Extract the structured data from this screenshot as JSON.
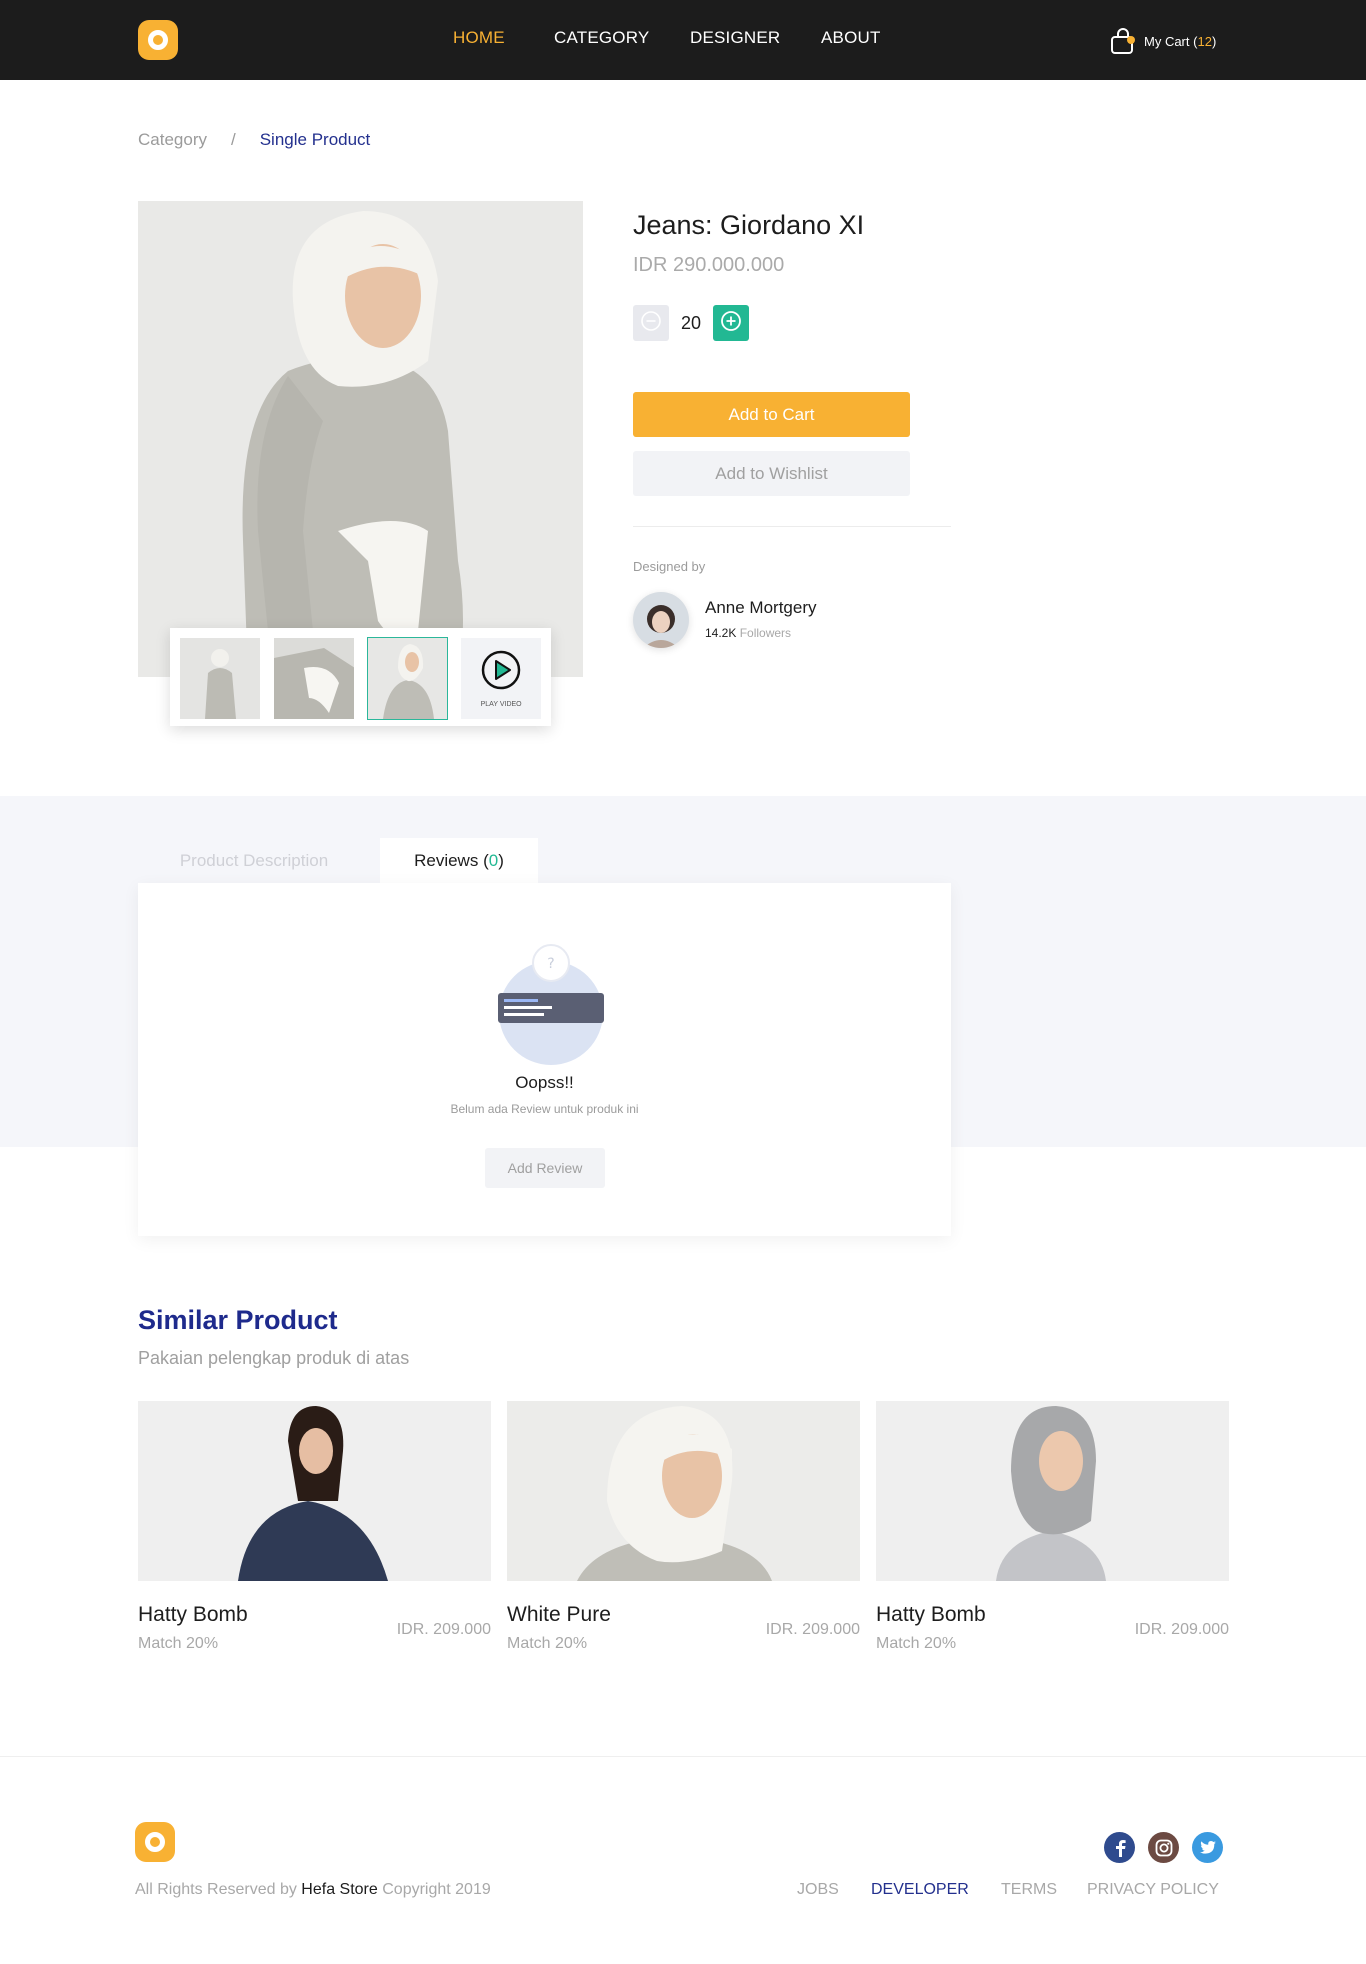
{
  "nav": {
    "items": [
      {
        "label": "HOME",
        "active": true
      },
      {
        "label": "CATEGORY",
        "active": false
      },
      {
        "label": "DESIGNER",
        "active": false
      },
      {
        "label": "ABOUT",
        "active": false
      }
    ],
    "cart_label": "My Cart",
    "cart_count": "12",
    "cart_open": "(",
    "cart_close": ")"
  },
  "breadcrumb": {
    "parent": "Category",
    "separator": "/",
    "current": "Single Product"
  },
  "product": {
    "title": "Jeans: Giordano XI",
    "price": "IDR 290.000.000",
    "quantity": "20",
    "add_to_cart": "Add to Cart",
    "add_to_wishlist": "Add to Wishlist",
    "play_video_label": "PLAY VIDEO"
  },
  "designer": {
    "heading": "Designed by",
    "name": "Anne Mortgery",
    "followers": "14.2K",
    "followers_label": "Followers"
  },
  "tabs": {
    "description": "Product Description",
    "reviews_label": "Reviews",
    "reviews_count": "0",
    "reviews_open": "(",
    "reviews_close": ")"
  },
  "reviews": {
    "empty_title": "Oopss!!",
    "empty_text": "Belum ada Review untuk produk ini",
    "add_review": "Add Review"
  },
  "similar": {
    "title": "Similar Product",
    "subtitle": "Pakaian pelengkap produk di atas",
    "items": [
      {
        "name": "Hatty Bomb",
        "match": "Match 20%",
        "price": "IDR. 209.000"
      },
      {
        "name": "White Pure",
        "match": "Match 20%",
        "price": "IDR. 209.000"
      },
      {
        "name": "Hatty Bomb",
        "match": "Match 20%",
        "price": "IDR. 209.000"
      }
    ]
  },
  "footer": {
    "copyright_prefix": "All Rights Reserved by",
    "store": "Hefa Store",
    "copyright_suffix": "Copyright 2019",
    "links": [
      "JOBS",
      "DEVELOPER",
      "TERMS",
      "PRIVACY POLICY"
    ],
    "active_link": "DEVELOPER"
  },
  "colors": {
    "accent": "#f8b133",
    "brand_blue": "#1e2a8c",
    "green": "#22b893",
    "header_bg": "#1c1c1c"
  },
  "icons": [
    "logo-icon",
    "cart-bag-icon",
    "minus-circle-icon",
    "plus-circle-icon",
    "play-icon",
    "question-icon",
    "facebook-icon",
    "instagram-icon",
    "twitter-icon"
  ]
}
